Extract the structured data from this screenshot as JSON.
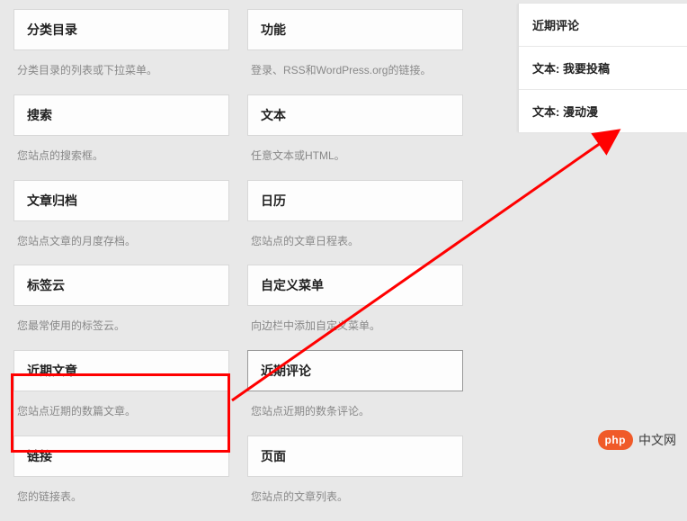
{
  "left_col": [
    {
      "title": "分类目录",
      "desc": "分类目录的列表或下拉菜单。"
    },
    {
      "title": "搜索",
      "desc": "您站点的搜索框。"
    },
    {
      "title": "文章归档",
      "desc": "您站点文章的月度存档。"
    },
    {
      "title": "标签云",
      "desc": "您最常使用的标签云。"
    },
    {
      "title": "近期文章",
      "desc": "您站点近期的数篇文章。"
    },
    {
      "title": "链接",
      "desc": "您的链接表。"
    }
  ],
  "mid_col": [
    {
      "title": "功能",
      "desc": "登录、RSS和WordPress.org的链接。"
    },
    {
      "title": "文本",
      "desc": "任意文本或HTML。"
    },
    {
      "title": "日历",
      "desc": "您站点的文章日程表。"
    },
    {
      "title": "自定义菜单",
      "desc": "向边栏中添加自定义菜单。"
    },
    {
      "title": "近期评论",
      "desc": "您站点近期的数条评论。",
      "active": true
    },
    {
      "title": "页面",
      "desc": "您站点的文章列表。"
    }
  ],
  "right_panel": [
    {
      "label": "近期评论"
    },
    {
      "label": "文本: 我要投稿"
    },
    {
      "label": "文本: 漫动漫"
    }
  ],
  "logo": {
    "badge": "php",
    "text": "中文网"
  }
}
